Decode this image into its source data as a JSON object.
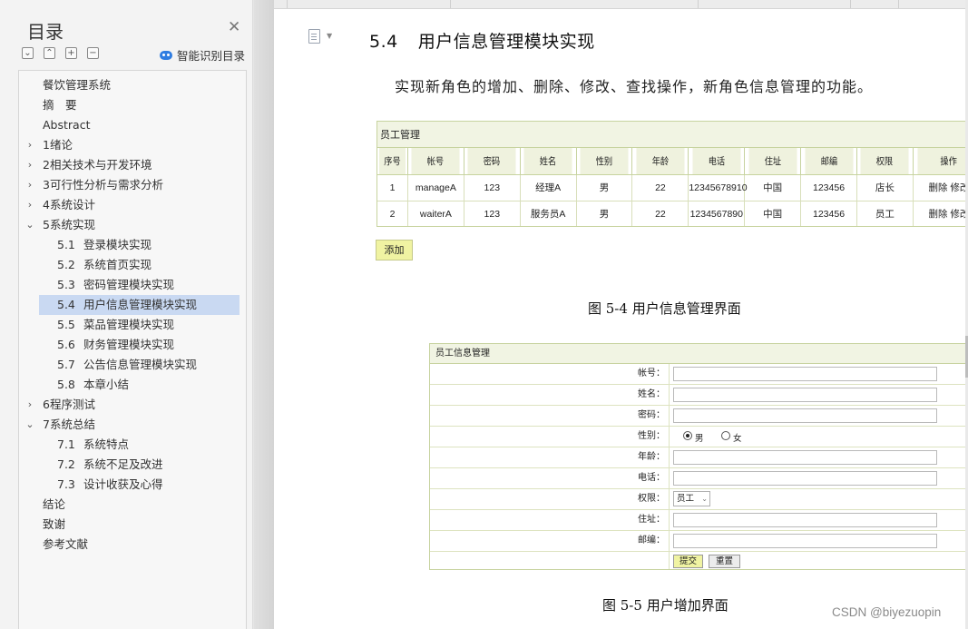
{
  "nav": {
    "title": "目录",
    "tools": [
      "⌄",
      "⌃",
      "+",
      "−"
    ],
    "smart_toc": "智能识别目录"
  },
  "toc": [
    {
      "num": "",
      "label": "餐饮管理系统",
      "level": 0,
      "arrow": ""
    },
    {
      "num": "",
      "label": "摘　要",
      "level": 0,
      "arrow": ""
    },
    {
      "num": "",
      "label": "Abstract",
      "level": 0,
      "arrow": ""
    },
    {
      "num": "",
      "label": "1绪论",
      "level": 0,
      "arrow": "›"
    },
    {
      "num": "",
      "label": "2相关技术与开发环境",
      "level": 0,
      "arrow": "›"
    },
    {
      "num": "",
      "label": "3可行性分析与需求分析",
      "level": 0,
      "arrow": "›"
    },
    {
      "num": "",
      "label": "4系统设计",
      "level": 0,
      "arrow": "›"
    },
    {
      "num": "",
      "label": "5系统实现",
      "level": 0,
      "arrow": "⌄"
    },
    {
      "num": "5.1",
      "label": "登录模块实现",
      "level": 1,
      "arrow": ""
    },
    {
      "num": "5.2",
      "label": "系统首页实现",
      "level": 1,
      "arrow": ""
    },
    {
      "num": "5.3",
      "label": "密码管理模块实现",
      "level": 1,
      "arrow": ""
    },
    {
      "num": "5.4",
      "label": "用户信息管理模块实现",
      "level": 1,
      "arrow": "",
      "selected": true
    },
    {
      "num": "5.5",
      "label": "菜品管理模块实现",
      "level": 1,
      "arrow": ""
    },
    {
      "num": "5.6",
      "label": "财务管理模块实现",
      "level": 1,
      "arrow": ""
    },
    {
      "num": "5.7",
      "label": "公告信息管理模块实现",
      "level": 1,
      "arrow": ""
    },
    {
      "num": "5.8",
      "label": "本章小结",
      "level": 1,
      "arrow": ""
    },
    {
      "num": "",
      "label": "6程序测试",
      "level": 0,
      "arrow": "›"
    },
    {
      "num": "",
      "label": "7系统总结",
      "level": 0,
      "arrow": "⌄"
    },
    {
      "num": "7.1",
      "label": "系统特点",
      "level": 1,
      "arrow": ""
    },
    {
      "num": "7.2",
      "label": "系统不足及改进",
      "level": 1,
      "arrow": ""
    },
    {
      "num": "7.3",
      "label": "设计收获及心得",
      "level": 1,
      "arrow": ""
    },
    {
      "num": "",
      "label": "结论",
      "level": 0,
      "arrow": ""
    },
    {
      "num": "",
      "label": "致谢",
      "level": 0,
      "arrow": ""
    },
    {
      "num": "",
      "label": "参考文献",
      "level": 0,
      "arrow": ""
    }
  ],
  "doc": {
    "heading_num": "5.4",
    "heading_text": "用户信息管理模块实现",
    "paragraph": "实现新角色的增加、删除、修改、查找操作，新角色信息管理的功能。",
    "fig1_caption": "图 5-4  用户信息管理界面",
    "fig2_caption": "图 5-5  用户增加界面"
  },
  "staff_table": {
    "title": "员工管理",
    "columns": [
      "序号",
      "帐号",
      "密码",
      "姓名",
      "性别",
      "年龄",
      "电话",
      "住址",
      "邮编",
      "权限",
      "操作"
    ],
    "rows": [
      [
        "1",
        "manageA",
        "123",
        "经理A",
        "男",
        "22",
        "12345678910",
        "中国",
        "123456",
        "店长",
        "删除 修改"
      ],
      [
        "2",
        "waiterA",
        "123",
        "服务员A",
        "男",
        "22",
        "1234567890",
        "中国",
        "123456",
        "员工",
        "删除 修改"
      ]
    ],
    "add_button": "添加"
  },
  "staff_form": {
    "title": "员工信息管理",
    "fields": {
      "account": "帐号：",
      "name": "姓名：",
      "password": "密码：",
      "gender": "性别：",
      "age": "年龄：",
      "phone": "电话：",
      "role": "权限：",
      "address": "住址：",
      "postcode": "邮编："
    },
    "gender_options": [
      "男",
      "女"
    ],
    "role_value": "员工",
    "submit": "提交",
    "reset": "重置"
  },
  "watermark": "CSDN @biyezuopin"
}
